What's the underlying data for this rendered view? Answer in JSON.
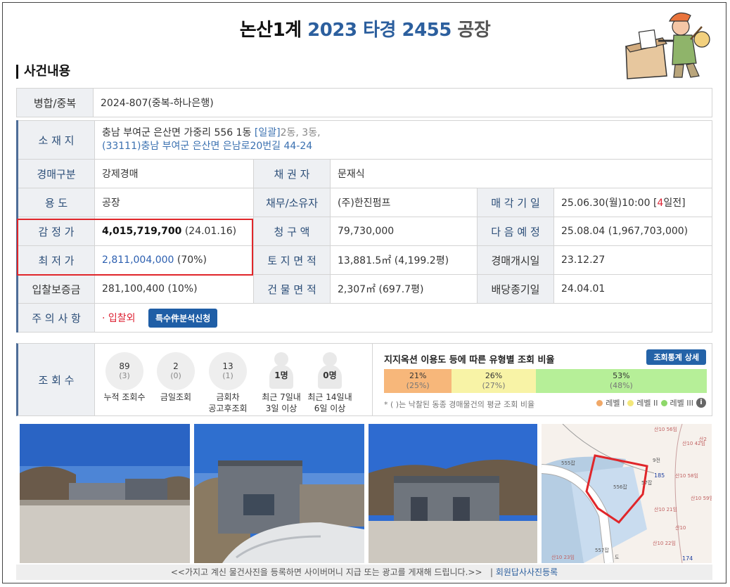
{
  "title": {
    "court": "논산1계",
    "case_no": "2023 타경 2455",
    "type": "공장"
  },
  "section_title": "사건내용",
  "merge": {
    "label": "병합/중복",
    "value": "2024-807(중복-하나은행)"
  },
  "location": {
    "label": "소 재 지",
    "line1": "충남 부여군 은산면 가중리 556 1동",
    "bulk": "[일괄]",
    "bulk_rest": "2동, 3동,",
    "line2": "(33111)충남 부여군  은산면 은남로20번길  44-24"
  },
  "auction_type": {
    "label": "경매구분",
    "value": "강제경매"
  },
  "creditor": {
    "label": "채 권 자",
    "value": "문재식"
  },
  "usage": {
    "label": "용      도",
    "value": "공장"
  },
  "debtor": {
    "label": "채무/소유자",
    "value": "(주)한진펌프"
  },
  "sale_date": {
    "label": "매 각 기 일",
    "value_pre": "25.06.30(월)10:00 [",
    "days": "4",
    "value_post": "일전]"
  },
  "appraisal": {
    "label": "감 정 가",
    "amount": "4,015,719,700",
    "date": "(24.01.16)"
  },
  "claim": {
    "label": "청 구 액",
    "value": "79,730,000"
  },
  "next_date": {
    "label": "다 음 예 정",
    "value": "25.08.04 (1,967,703,000)"
  },
  "minimum": {
    "label": "최 저 가",
    "amount": "2,811,004,000",
    "pct": "(70%)"
  },
  "land_area": {
    "label": "토 지 면 적",
    "value": "13,881.5㎡ (4,199.2평)"
  },
  "start_date": {
    "label": "경매개시일",
    "value": "23.12.27"
  },
  "deposit": {
    "label": "입찰보증금",
    "value": "281,100,400 (10%)"
  },
  "building_area": {
    "label": "건 물 면 적",
    "value": "2,307㎡ (697.7평)"
  },
  "dividend": {
    "label": "배당종기일",
    "value": "24.04.01"
  },
  "notes": {
    "label": "주 의 사 항",
    "item": "· 입찰외",
    "button": "특수件분석신청"
  },
  "views": {
    "label": "조 회 수",
    "total": {
      "n": "89",
      "s": "(3)",
      "label": "누적 조회수"
    },
    "today": {
      "n": "2",
      "s": "(0)",
      "label": "금일조회"
    },
    "after": {
      "n": "13",
      "s": "(1)",
      "label1": "금회차",
      "label2": "공고후조회"
    },
    "d7": {
      "n": "1명",
      "label1": "최근 7일내",
      "label2": "3일 이상"
    },
    "d14": {
      "n": "0명",
      "label1": "최근 14일내",
      "label2": "6일 이상"
    }
  },
  "ratio": {
    "title": "지지옥션 이용도 등에 따른 유형별 조회 비율",
    "button": "조회통계 상세",
    "segments": [
      {
        "pct": "21%",
        "sub": "(25%)",
        "value": 21,
        "color": "#f7b77a"
      },
      {
        "pct": "26%",
        "sub": "(27%)",
        "value": 26,
        "color": "#f8f3a6"
      },
      {
        "pct": "53%",
        "sub": "(48%)",
        "value": 53,
        "color": "#b6ef98"
      }
    ],
    "note": "* ( )는 낙찰된 동종 경매물건의 평균 조회 비율",
    "legend": [
      "레벨 I",
      "레벨 II",
      "레벨 III"
    ],
    "legend_colors": [
      "#f0a868",
      "#f3e77a",
      "#8ed86a"
    ]
  },
  "caption": {
    "text": "<<가지고 계신 물건사진을 등록하면 사이버머니 지급 또는 광고를 게재해 드립니다.>>",
    "sep": "|",
    "link": "회원답사사진등록"
  },
  "map_labels": [
    "555잡",
    "556잡",
    "57잡",
    "185",
    "산10 21임",
    "557잡",
    "산10 56임",
    "산10 58임",
    "산10 42임",
    "174",
    "산10 22임",
    "산2",
    "산10",
    "도",
    "9전",
    "산10 59임",
    "산10 23임"
  ]
}
